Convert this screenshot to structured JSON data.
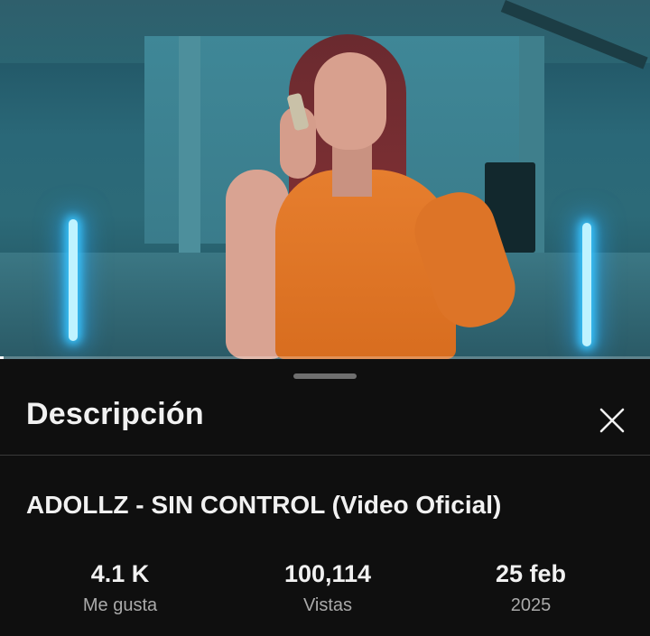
{
  "video": {
    "progress": 0.004
  },
  "sheet": {
    "title": "Descripción",
    "close_icon": "close-icon"
  },
  "details": {
    "video_title": "ADOLLZ - SIN CONTROL (Video Oficial)",
    "stats": [
      {
        "value": "4.1 K",
        "label": "Me gusta"
      },
      {
        "value": "100,114",
        "label": "Vistas"
      },
      {
        "value": "25 feb",
        "label": "2025"
      }
    ]
  },
  "colors": {
    "background": "#0f0f0f",
    "primary_text": "#f1f1f1",
    "secondary_text": "#aaaaaa",
    "divider": "#3a3a3a",
    "handle": "#6f6f6f"
  }
}
